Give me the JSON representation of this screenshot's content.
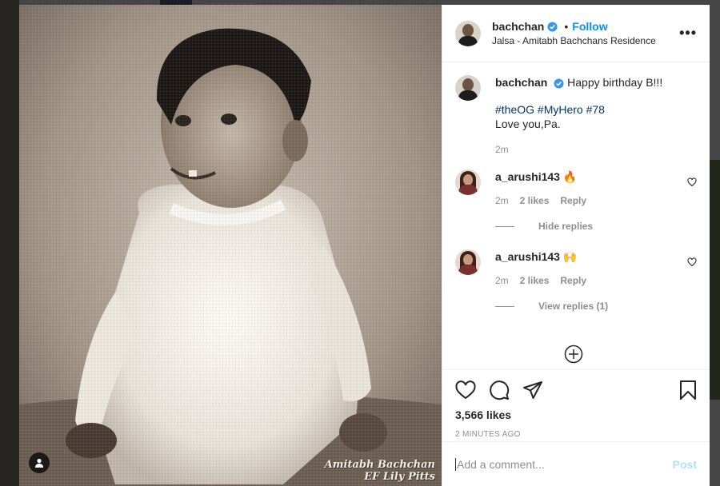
{
  "post": {
    "author": "bachchan",
    "verified": true,
    "follow_label": "Follow",
    "separator": "•",
    "location": "Jalsa - Amitabh Bachchans Residence",
    "more_label": "•••",
    "watermark_line1": "Amitabh Bachchan",
    "watermark_line2": "EF Lily Pitts"
  },
  "caption": {
    "user": "bachchan",
    "text": "Happy birthday B!!!",
    "hashtags": "#theOG #MyHero #78",
    "line2": "Love you,Pa.",
    "time": "2m"
  },
  "comments": [
    {
      "user": "a_arushi143",
      "text": "🔥",
      "time": "2m",
      "likes": "2 likes",
      "reply": "Reply",
      "replies_toggle": "Hide replies"
    },
    {
      "user": "a_arushi143",
      "text": "🙌",
      "time": "2m",
      "likes": "2 likes",
      "reply": "Reply",
      "replies_toggle": "View replies (1)"
    }
  ],
  "stats": {
    "likes": "3,566 likes",
    "time_ago": "2 MINUTES AGO"
  },
  "comment_box": {
    "placeholder": "Add a comment...",
    "post_label": "Post"
  },
  "colors": {
    "accent": "#0095f6",
    "verified": "#3897f0",
    "muted": "#8e8e8e",
    "post_disabled": "#b2dffc"
  },
  "icons": {
    "like": "heart-icon",
    "comment": "comment-icon",
    "share": "paper-plane-icon",
    "save": "bookmark-icon",
    "load_more": "plus-circle-icon",
    "user_tag": "user-icon"
  }
}
